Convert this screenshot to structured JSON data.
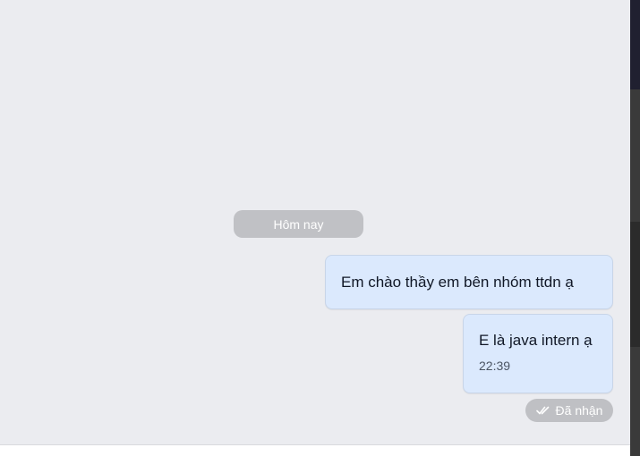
{
  "chat": {
    "date_divider": "Hôm nay",
    "messages": [
      {
        "text": "Em chào thầy em bên nhóm ttdn ạ"
      },
      {
        "text": "E là java intern ạ",
        "time": "22:39"
      }
    ],
    "status": {
      "icon": "double-check-icon",
      "label": "Đã nhận"
    }
  },
  "colors": {
    "chat_background": "#ebecf0",
    "bubble_outgoing": "#dbe9fd",
    "divider_pill": "#c0c1c5"
  }
}
